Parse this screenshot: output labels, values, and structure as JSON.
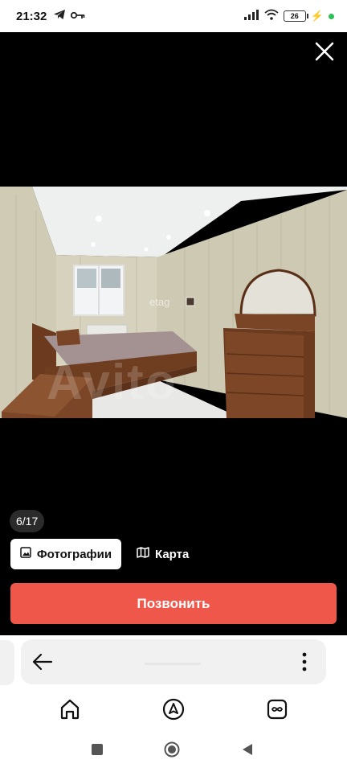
{
  "status_bar": {
    "time": "21:32",
    "battery_level": "26",
    "icons": [
      "telegram-icon",
      "vpn-key-icon",
      "signal-icon",
      "wifi-icon",
      "battery-icon",
      "charging-icon",
      "dot-icon"
    ]
  },
  "viewer": {
    "counter": "6/17",
    "photos_tab": "Фотографии",
    "map_tab": "Карта",
    "call_button": "Позвонить",
    "watermark_text": "Avito",
    "photo_badge": "etag"
  },
  "colors": {
    "accent_red": "#f0574b",
    "background": "#000000",
    "status_dot": "#2fbf57"
  },
  "browser": {
    "icons": [
      "back-arrow-icon",
      "more-vertical-icon",
      "home-icon",
      "alice-icon",
      "tabs-icon"
    ]
  }
}
